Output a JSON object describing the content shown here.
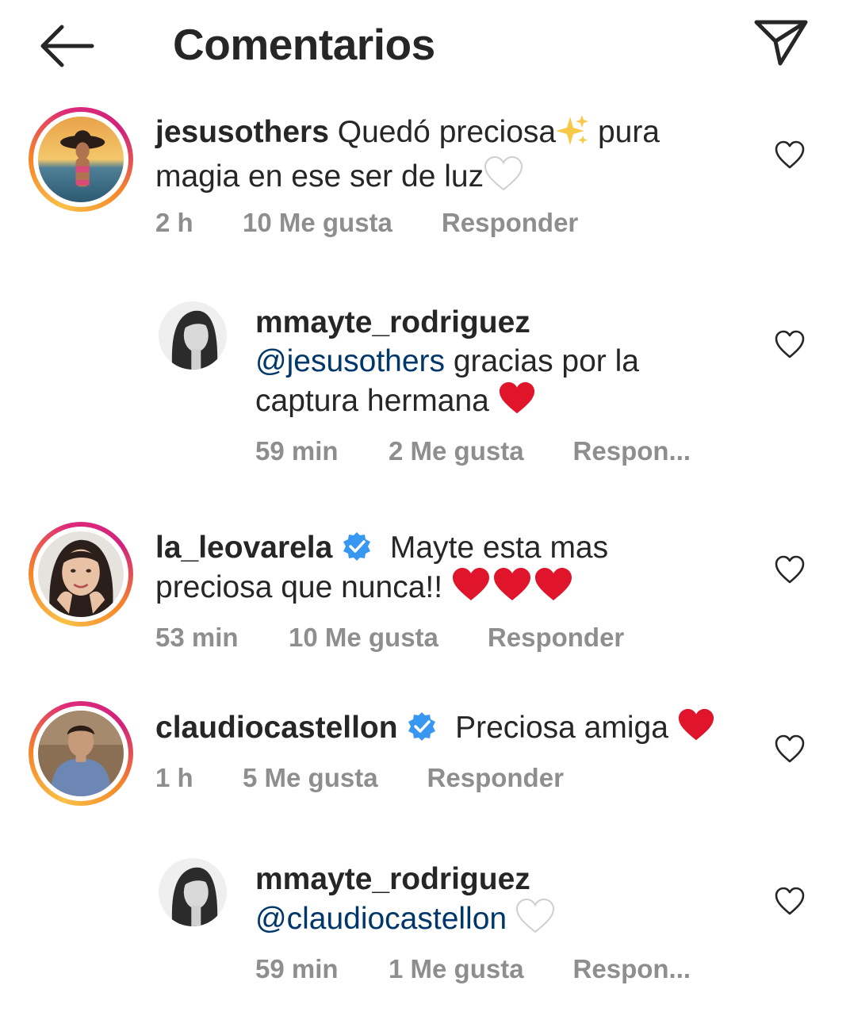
{
  "header": {
    "title": "Comentarios",
    "back_icon": "arrow-left-icon",
    "send_icon": "paper-plane-icon"
  },
  "comments": [
    {
      "username": "jesusothers",
      "text_1": " Quedó preciosa",
      "emoji_1": "sparkles",
      "text_2": " pura magia en ese ser de luz",
      "emoji_2": "white-heart",
      "time": "2 h",
      "likes": "10 Me gusta",
      "reply": "Responder"
    },
    {
      "username": "mmayte_rodriguez",
      "mention": "@jesusothers",
      "text": " gracias por la captura hermana ",
      "emoji": "red-heart",
      "time": "59 min",
      "likes": "2 Me gusta",
      "reply": "Respon..."
    },
    {
      "username": "la_leovarela",
      "verified": true,
      "text": "Mayte esta mas preciosa que nunca!! ",
      "emoji": "red-heart x3",
      "time": "53 min",
      "likes": "10 Me gusta",
      "reply": "Responder"
    },
    {
      "username": "claudiocastellon",
      "verified": true,
      "text": "Preciosa amiga ",
      "emoji": "red-heart",
      "time": "1 h",
      "likes": "5 Me gusta",
      "reply": "Responder"
    },
    {
      "username": "mmayte_rodriguez",
      "mention": "@claudiocastellon",
      "emoji": "white-heart",
      "time": "59 min",
      "likes": "1 Me gusta",
      "reply": "Respon..."
    }
  ],
  "colors": {
    "text": "#262626",
    "meta": "#8e8e8e",
    "mention": "#00376b",
    "verified": "#3897f0",
    "heart_red": "#e0142a"
  }
}
